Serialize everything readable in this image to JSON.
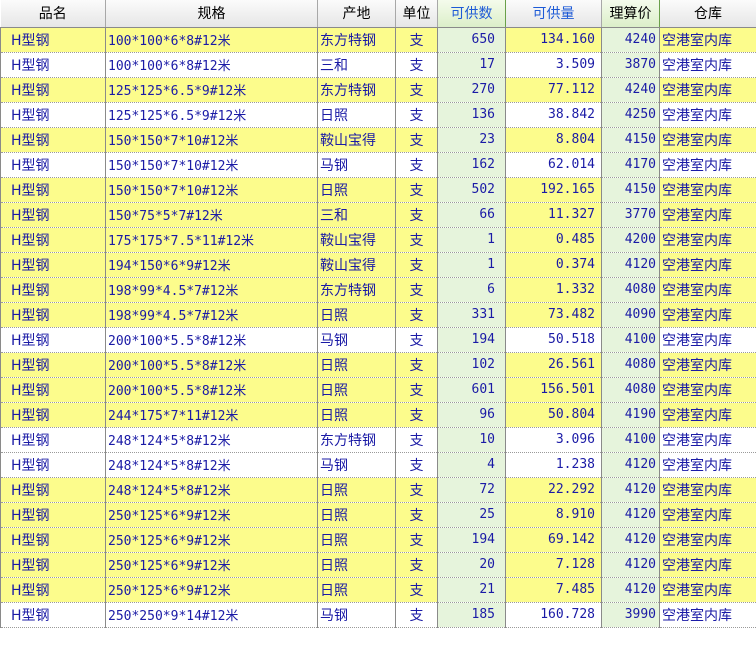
{
  "columns": [
    {
      "key": "name",
      "label": "品名"
    },
    {
      "key": "spec",
      "label": "规格"
    },
    {
      "key": "origin",
      "label": "产地"
    },
    {
      "key": "unit",
      "label": "单位"
    },
    {
      "key": "supply_qty",
      "label": "可供数"
    },
    {
      "key": "supply_weight",
      "label": "可供量"
    },
    {
      "key": "calc_price",
      "label": "理算价"
    },
    {
      "key": "warehouse",
      "label": "仓库"
    }
  ],
  "rows": [
    {
      "name": "H型钢",
      "spec": "100*100*6*8#12米",
      "origin": "东方特钢",
      "unit": "支",
      "supply_qty": "650",
      "supply_weight": "134.160",
      "calc_price": "4240",
      "warehouse": "空港室内库",
      "hl": "yellow"
    },
    {
      "name": "H型钢",
      "spec": "100*100*6*8#12米",
      "origin": "三和",
      "unit": "支",
      "supply_qty": "17",
      "supply_weight": "3.509",
      "calc_price": "3870",
      "warehouse": "空港室内库",
      "hl": "white"
    },
    {
      "name": "H型钢",
      "spec": "125*125*6.5*9#12米",
      "origin": "东方特钢",
      "unit": "支",
      "supply_qty": "270",
      "supply_weight": "77.112",
      "calc_price": "4240",
      "warehouse": "空港室内库",
      "hl": "yellow"
    },
    {
      "name": "H型钢",
      "spec": "125*125*6.5*9#12米",
      "origin": "日照",
      "unit": "支",
      "supply_qty": "136",
      "supply_weight": "38.842",
      "calc_price": "4250",
      "warehouse": "空港室内库",
      "hl": "white"
    },
    {
      "name": "H型钢",
      "spec": "150*150*7*10#12米",
      "origin": "鞍山宝得",
      "unit": "支",
      "supply_qty": "23",
      "supply_weight": "8.804",
      "calc_price": "4150",
      "warehouse": "空港室内库",
      "hl": "yellow"
    },
    {
      "name": "H型钢",
      "spec": "150*150*7*10#12米",
      "origin": "马钢",
      "unit": "支",
      "supply_qty": "162",
      "supply_weight": "62.014",
      "calc_price": "4170",
      "warehouse": "空港室内库",
      "hl": "white"
    },
    {
      "name": "H型钢",
      "spec": "150*150*7*10#12米",
      "origin": "日照",
      "unit": "支",
      "supply_qty": "502",
      "supply_weight": "192.165",
      "calc_price": "4150",
      "warehouse": "空港室内库",
      "hl": "yellow"
    },
    {
      "name": "H型钢",
      "spec": "150*75*5*7#12米",
      "origin": "三和",
      "unit": "支",
      "supply_qty": "66",
      "supply_weight": "11.327",
      "calc_price": "3770",
      "warehouse": "空港室内库",
      "hl": "yellow"
    },
    {
      "name": "H型钢",
      "spec": "175*175*7.5*11#12米",
      "origin": "鞍山宝得",
      "unit": "支",
      "supply_qty": "1",
      "supply_weight": "0.485",
      "calc_price": "4200",
      "warehouse": "空港室内库",
      "hl": "yellow"
    },
    {
      "name": "H型钢",
      "spec": "194*150*6*9#12米",
      "origin": "鞍山宝得",
      "unit": "支",
      "supply_qty": "1",
      "supply_weight": "0.374",
      "calc_price": "4120",
      "warehouse": "空港室内库",
      "hl": "yellow"
    },
    {
      "name": "H型钢",
      "spec": "198*99*4.5*7#12米",
      "origin": "东方特钢",
      "unit": "支",
      "supply_qty": "6",
      "supply_weight": "1.332",
      "calc_price": "4080",
      "warehouse": "空港室内库",
      "hl": "yellow"
    },
    {
      "name": "H型钢",
      "spec": "198*99*4.5*7#12米",
      "origin": "日照",
      "unit": "支",
      "supply_qty": "331",
      "supply_weight": "73.482",
      "calc_price": "4090",
      "warehouse": "空港室内库",
      "hl": "yellow"
    },
    {
      "name": "H型钢",
      "spec": "200*100*5.5*8#12米",
      "origin": "马钢",
      "unit": "支",
      "supply_qty": "194",
      "supply_weight": "50.518",
      "calc_price": "4100",
      "warehouse": "空港室内库",
      "hl": "white"
    },
    {
      "name": "H型钢",
      "spec": "200*100*5.5*8#12米",
      "origin": "日照",
      "unit": "支",
      "supply_qty": "102",
      "supply_weight": "26.561",
      "calc_price": "4080",
      "warehouse": "空港室内库",
      "hl": "yellow"
    },
    {
      "name": "H型钢",
      "spec": "200*100*5.5*8#12米",
      "origin": "日照",
      "unit": "支",
      "supply_qty": "601",
      "supply_weight": "156.501",
      "calc_price": "4080",
      "warehouse": "空港室内库",
      "hl": "yellow"
    },
    {
      "name": "H型钢",
      "spec": "244*175*7*11#12米",
      "origin": "日照",
      "unit": "支",
      "supply_qty": "96",
      "supply_weight": "50.804",
      "calc_price": "4190",
      "warehouse": "空港室内库",
      "hl": "yellow"
    },
    {
      "name": "H型钢",
      "spec": "248*124*5*8#12米",
      "origin": "东方特钢",
      "unit": "支",
      "supply_qty": "10",
      "supply_weight": "3.096",
      "calc_price": "4100",
      "warehouse": "空港室内库",
      "hl": "white"
    },
    {
      "name": "H型钢",
      "spec": "248*124*5*8#12米",
      "origin": "马钢",
      "unit": "支",
      "supply_qty": "4",
      "supply_weight": "1.238",
      "calc_price": "4120",
      "warehouse": "空港室内库",
      "hl": "white"
    },
    {
      "name": "H型钢",
      "spec": "248*124*5*8#12米",
      "origin": "日照",
      "unit": "支",
      "supply_qty": "72",
      "supply_weight": "22.292",
      "calc_price": "4120",
      "warehouse": "空港室内库",
      "hl": "yellow"
    },
    {
      "name": "H型钢",
      "spec": "250*125*6*9#12米",
      "origin": "日照",
      "unit": "支",
      "supply_qty": "25",
      "supply_weight": "8.910",
      "calc_price": "4120",
      "warehouse": "空港室内库",
      "hl": "yellow"
    },
    {
      "name": "H型钢",
      "spec": "250*125*6*9#12米",
      "origin": "日照",
      "unit": "支",
      "supply_qty": "194",
      "supply_weight": "69.142",
      "calc_price": "4120",
      "warehouse": "空港室内库",
      "hl": "yellow"
    },
    {
      "name": "H型钢",
      "spec": "250*125*6*9#12米",
      "origin": "日照",
      "unit": "支",
      "supply_qty": "20",
      "supply_weight": "7.128",
      "calc_price": "4120",
      "warehouse": "空港室内库",
      "hl": "yellow"
    },
    {
      "name": "H型钢",
      "spec": "250*125*6*9#12米",
      "origin": "日照",
      "unit": "支",
      "supply_qty": "21",
      "supply_weight": "7.485",
      "calc_price": "4120",
      "warehouse": "空港室内库",
      "hl": "yellow"
    },
    {
      "name": "H型钢",
      "spec": "250*250*9*14#12米",
      "origin": "马钢",
      "unit": "支",
      "supply_qty": "185",
      "supply_weight": "160.728",
      "calc_price": "3990",
      "warehouse": "空港室内库",
      "hl": "white"
    }
  ],
  "colors": {
    "row_highlight": "#fcfc8c",
    "row_plain": "#ffffff",
    "cell_text": "#1a1aa6",
    "column_highlight": "#e6f4dc",
    "header_accent_text": "#1d5ad6"
  }
}
